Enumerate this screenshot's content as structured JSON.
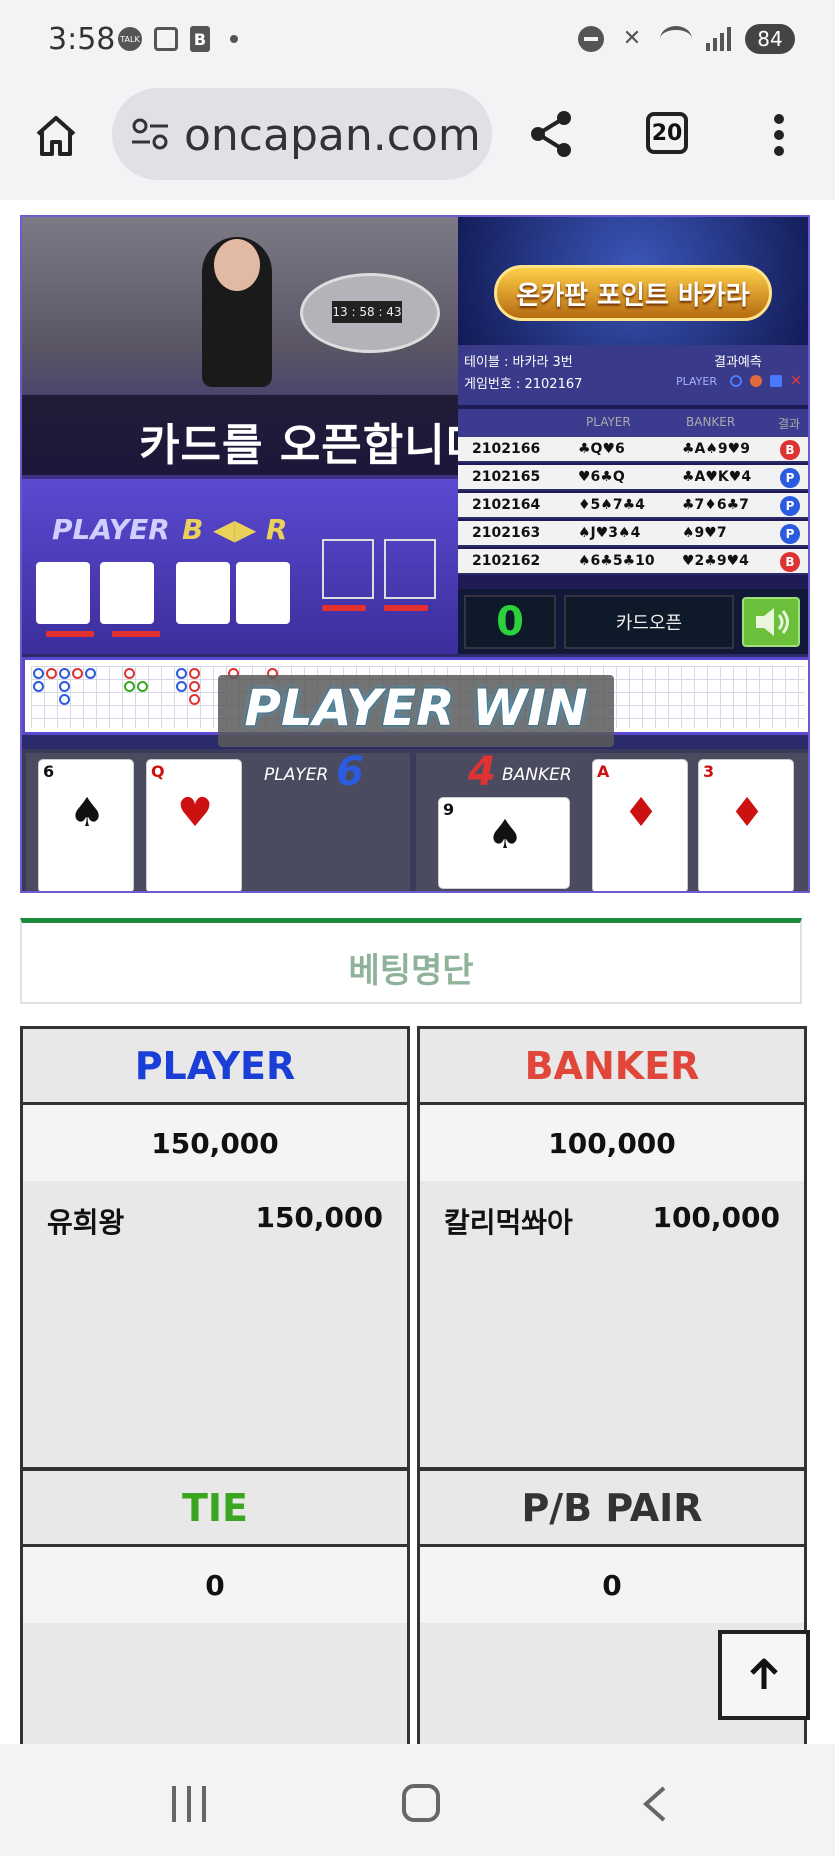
{
  "status_bar": {
    "time": "3:58",
    "left_icons": [
      "talk-icon",
      "screenshot-icon",
      "b-app-icon",
      "dot-icon"
    ],
    "right_icons": [
      "dnd-icon",
      "mute-icon",
      "wifi-icon",
      "signal-icon"
    ],
    "battery": "84"
  },
  "browser": {
    "url": "oncapan.com",
    "tab_count": "20"
  },
  "game": {
    "overlay_text": "카드를 오픈합니다.",
    "table_timer": "13 : 58 : 43",
    "player_label": "PLAYER",
    "banker_label": "B",
    "banker_label_end": "R",
    "logo_text": "온카판 포인트 바카라",
    "table_info": "테이블 : 바카라 3번",
    "game_number": "게임번호 : 2102167",
    "prediction_label": "결과예측",
    "prediction_player": "PLAYER",
    "history_headers": [
      "PLAYER",
      "BANKER",
      "결과"
    ],
    "history": [
      {
        "id": "2102166",
        "player": "♣Q♥6",
        "banker": "♣A♠9♥9",
        "result": "B"
      },
      {
        "id": "2102165",
        "player": "♥6♣Q",
        "banker": "♣A♥K♥4",
        "result": "P"
      },
      {
        "id": "2102164",
        "player": "♦5♠7♣4",
        "banker": "♣7♦6♣7",
        "result": "P"
      },
      {
        "id": "2102163",
        "player": "♠J♥3♠4",
        "banker": "♠9♥7",
        "result": "P"
      },
      {
        "id": "2102162",
        "player": "♠6♣5♣10",
        "banker": "♥2♣9♥4",
        "result": "B"
      }
    ],
    "counter": "0",
    "open_button": "카드오픈",
    "win_text": "PLAYER WIN",
    "result_player_label": "PLAYER",
    "result_player_score": "6",
    "result_banker_label": "BANKER",
    "result_banker_score": "4",
    "player_cards": [
      {
        "rank": "6",
        "suit": "♠",
        "color": "#111111"
      },
      {
        "rank": "Q",
        "suit": "♥",
        "color": "#cc1111"
      }
    ],
    "banker_cards": [
      {
        "rank": "9",
        "suit": "♠",
        "color": "#111111"
      },
      {
        "rank": "A",
        "suit": "♦",
        "color": "#cc1111"
      },
      {
        "rank": "3",
        "suit": "♦",
        "color": "#cc1111"
      }
    ]
  },
  "betting": {
    "title": "베팅명단",
    "panels": [
      {
        "name": "PLAYER",
        "color": "#1a3fd6",
        "total": "150,000",
        "bettors": [
          {
            "name": "유희왕",
            "amount": "150,000"
          }
        ]
      },
      {
        "name": "BANKER",
        "color": "#e0463a",
        "total": "100,000",
        "bettors": [
          {
            "name": "칼리먹쏴아",
            "amount": "100,000"
          }
        ]
      },
      {
        "name": "TIE",
        "color": "#3aa61f",
        "total": "0",
        "bettors": []
      },
      {
        "name": "P/B PAIR",
        "color": "#333333",
        "total": "0",
        "bettors": []
      }
    ]
  }
}
